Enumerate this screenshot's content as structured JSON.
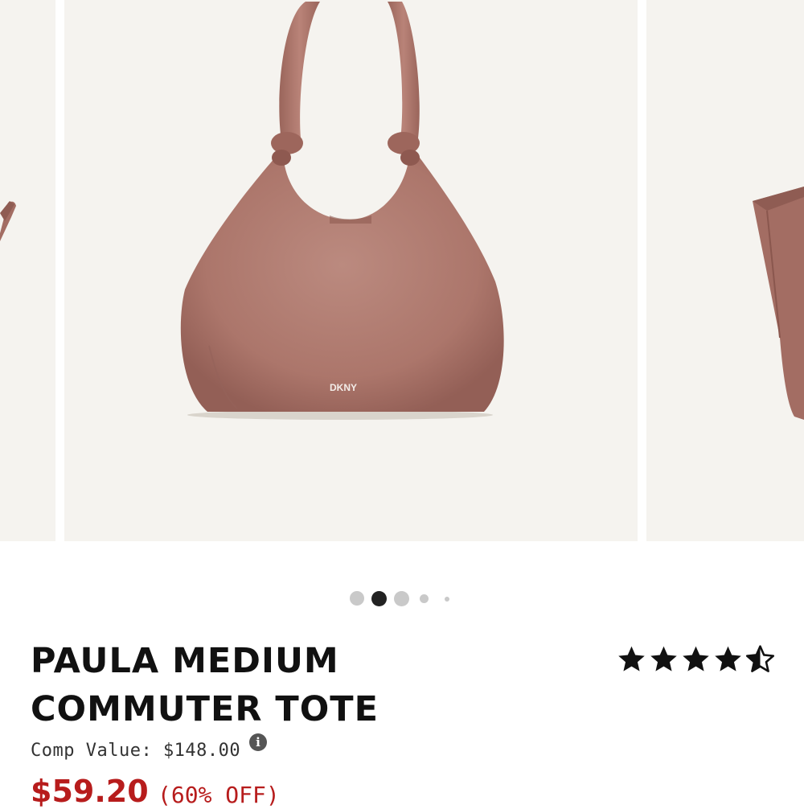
{
  "product": {
    "brand_logo": "DKNY",
    "title_line1": "PAULA MEDIUM",
    "title_line2": "COMMUTER TOTE",
    "rating": {
      "value": 4.5,
      "max": 5
    },
    "comp_value": "Comp Value: $148.00",
    "price": "$59.20",
    "discount": "(60% OFF)"
  },
  "carousel": {
    "active_index": 1,
    "dot_count": 5
  },
  "icons": {
    "info": "i",
    "star": "star-icon"
  },
  "colors": {
    "image_background": "#f5f3ef",
    "bag": "#b07a6f",
    "price_red": "#b71c1c",
    "dot_active": "#222222",
    "dot_inactive": "#c9c9c9"
  }
}
